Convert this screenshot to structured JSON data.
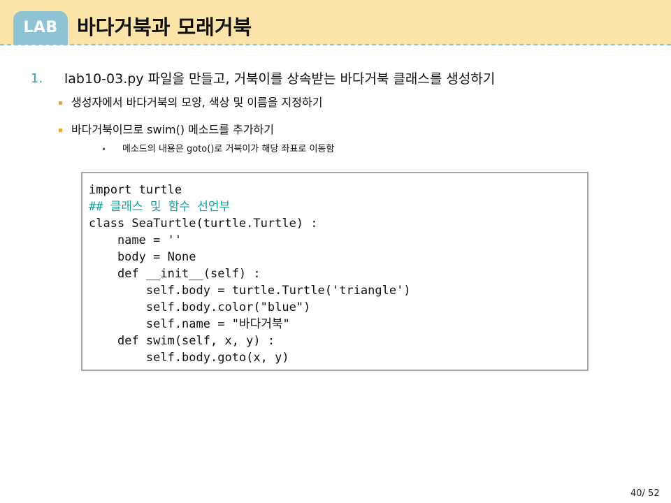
{
  "header": {
    "badge": "LAB",
    "title": "바다거북과 모래거북",
    "colors": {
      "band": "#fbe4a9",
      "badge": "#8ec3d3",
      "dashed_line": "#8ec3d3"
    }
  },
  "content": {
    "step_number": "1.",
    "step_text": "lab10-03.py 파일을 만들고, 거북이를 상속받는 바다거북 클래스를 생성하기",
    "bullets": [
      {
        "text": "생성자에서 바다거북의 모양, 색상 및 이름을 지정하기"
      },
      {
        "text": "바다거북이므로 swim() 메소드를 추가하기",
        "sub_items": [
          "메소드의 내용은 goto()로 거북이가 해당 좌표로 이동함"
        ]
      }
    ],
    "bullet_color": "#e8a33a",
    "step_number_color": "#2aa0d0"
  },
  "code": {
    "lines": [
      "import turtle",
      "## 클래스 및 함수 선언부",
      "class SeaTurtle(turtle.Turtle) :",
      "    name = ''",
      "    body = None",
      "    def __init__(self) :",
      "        self.body = turtle.Turtle('triangle')",
      "        self.body.color(\"blue\")",
      "        self.name = \"바다거북\"",
      "    def swim(self, x, y) :",
      "        self.body.goto(x, y)"
    ],
    "comment_color": "#12a39a"
  },
  "footer": {
    "page": "40/ 52"
  }
}
